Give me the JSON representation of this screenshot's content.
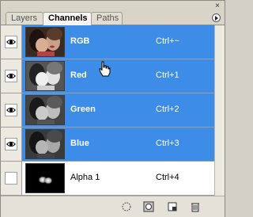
{
  "tabs": [
    {
      "label": "Layers"
    },
    {
      "label": "Channels",
      "active": true
    },
    {
      "label": "Paths"
    }
  ],
  "channels": [
    {
      "name": "RGB",
      "shortcut": "Ctrl+~",
      "visible": true,
      "selected": true,
      "thumb": "color-photo"
    },
    {
      "name": "Red",
      "shortcut": "Ctrl+1",
      "visible": true,
      "selected": true,
      "thumb": "gray-photo"
    },
    {
      "name": "Green",
      "shortcut": "Ctrl+2",
      "visible": true,
      "selected": true,
      "thumb": "gray-photo"
    },
    {
      "name": "Blue",
      "shortcut": "Ctrl+3",
      "visible": true,
      "selected": true,
      "thumb": "gray-photo"
    },
    {
      "name": "Alpha 1",
      "shortcut": "Ctrl+4",
      "visible": false,
      "selected": false,
      "thumb": "alpha-mask"
    }
  ],
  "colors": {
    "selection": "#3d8de8",
    "panel": "#ece9e0"
  },
  "bottom_icons": [
    "load-selection-icon",
    "save-selection-icon",
    "new-channel-icon",
    "delete-channel-icon"
  ]
}
